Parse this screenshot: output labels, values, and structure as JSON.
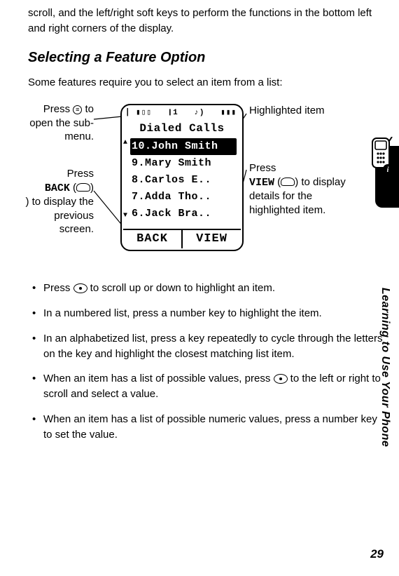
{
  "intro_fragment": "scroll, and the left/right soft keys to perform the functions in the bottom left and right corners of the display.",
  "heading": "Selecting a Feature Option",
  "lead": "Some features require you to select an item from a list:",
  "phone": {
    "status_left": "⎸▮▯▯",
    "status_mid": "❙1",
    "status_mid2": "♪)",
    "status_right": "▮▮▮",
    "title": "Dialed Calls",
    "rows": [
      "10.John Smith",
      "9.Mary Smith",
      "8.Carlos E..",
      "7.Adda Tho..",
      "6.Jack Bra.."
    ],
    "softkey_left": "BACK",
    "softkey_right": "VIEW"
  },
  "annotations": {
    "press_menu_pre": "Press ",
    "press_menu_post": " to open the sub-menu.",
    "press_back_pre": "Press ",
    "press_back_label": "BACK",
    "press_back_mid": " (",
    "press_back_post": ") to display the previous screen.",
    "highlighted_item": "Highlighted item",
    "press_view_pre": "Press ",
    "press_view_label": "VIEW",
    "press_view_mid": " (",
    "press_view_post": ") to display details for the highlighted item."
  },
  "bullets": {
    "b1_pre": "Press ",
    "b1_post": " to scroll up or down to highlight an item.",
    "b2": "In a numbered list, press a number key to highlight the item.",
    "b3": "In an alphabetized list, press a key repeatedly to cycle through the letters on the key and highlight the closest matching list item.",
    "b4_pre": "When an item has a list of possible values, press ",
    "b4_post": " to the left or right to scroll and select a value.",
    "b5": "When an item has a list of possible numeric values, press a number key to set the value."
  },
  "side_label": "Learning to Use Your Phone",
  "page_number": "29"
}
